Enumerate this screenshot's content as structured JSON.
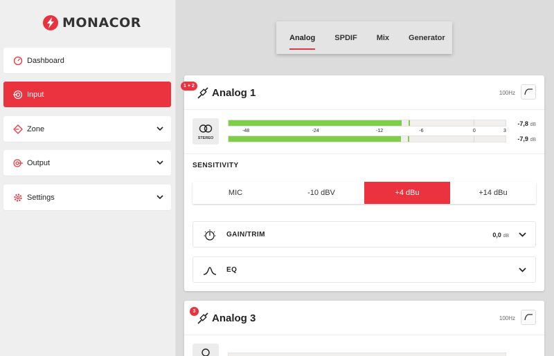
{
  "brand": {
    "name": "MONACOR",
    "color": "#ea333e"
  },
  "sidebar": {
    "items": [
      {
        "label": "Dashboard",
        "icon": "gauge-icon",
        "active": false,
        "expandable": false
      },
      {
        "label": "Input",
        "icon": "input-icon",
        "active": true,
        "expandable": false
      },
      {
        "label": "Zone",
        "icon": "zone-icon",
        "active": false,
        "expandable": true
      },
      {
        "label": "Output",
        "icon": "output-icon",
        "active": false,
        "expandable": true
      },
      {
        "label": "Settings",
        "icon": "gear-icon",
        "active": false,
        "expandable": true
      }
    ]
  },
  "tabs": [
    {
      "label": "Analog",
      "active": true
    },
    {
      "label": "SPDIF",
      "active": false
    },
    {
      "label": "Mix",
      "active": false
    },
    {
      "label": "Generator",
      "active": false
    }
  ],
  "cards": [
    {
      "badge": "1 + 2",
      "title": "Analog 1",
      "freq": "100Hz",
      "stereo_label": "STEREO",
      "meter_scale": [
        "-48",
        "-24",
        "-12",
        "-6",
        "0",
        "3"
      ],
      "meters": [
        {
          "value": "-7,8",
          "unit": "dB",
          "level": -7.8
        },
        {
          "value": "-7,9",
          "unit": "dB",
          "level": -7.9
        }
      ],
      "sensitivity": {
        "label": "SENSITIVITY",
        "options": [
          "MIC",
          "-10 dBV",
          "+4 dBu",
          "+14 dBu"
        ],
        "selected": "+4 dBu"
      },
      "gain": {
        "label": "GAIN/TRIM",
        "value": "0,0",
        "unit": "dB"
      },
      "eq": {
        "label": "EQ"
      }
    },
    {
      "badge": "3",
      "title": "Analog 3",
      "freq": "100Hz"
    }
  ]
}
